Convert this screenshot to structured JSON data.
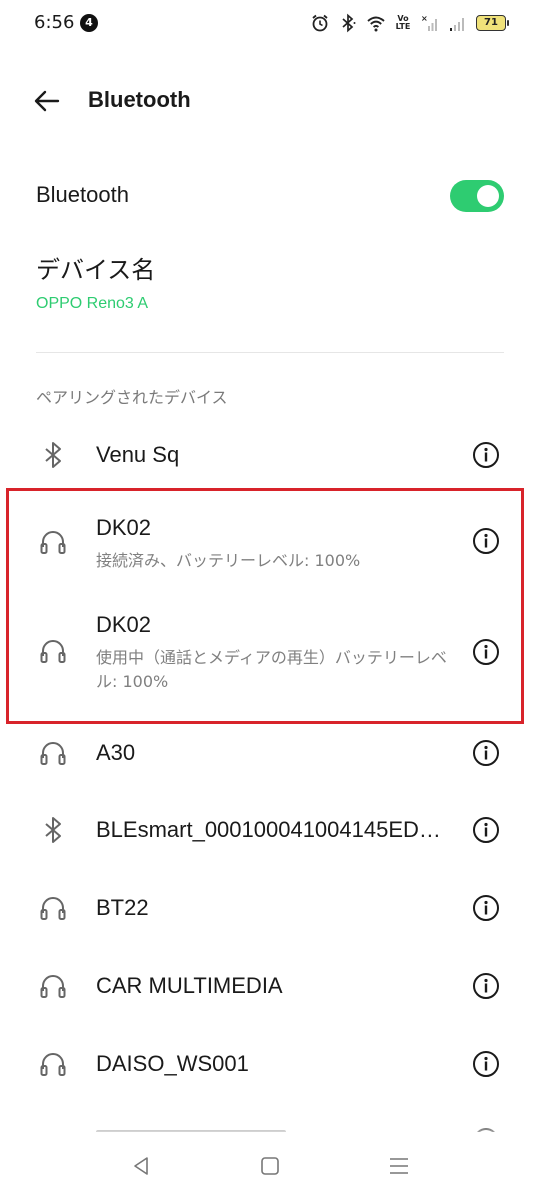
{
  "status_bar": {
    "time": "6:56",
    "notification_count": "4",
    "volte": "Vo LTE",
    "battery": "71"
  },
  "header": {
    "title": "Bluetooth"
  },
  "bluetooth_toggle": {
    "label": "Bluetooth",
    "enabled": true,
    "accent_color": "#2ecc71"
  },
  "device_name": {
    "label": "デバイス名",
    "value": "OPPO Reno3 A"
  },
  "paired_section": {
    "title": "ペアリングされたデバイス",
    "devices": [
      {
        "name": "Venu Sq",
        "icon": "bluetooth-icon",
        "status": ""
      },
      {
        "name": "DK02",
        "icon": "headphones-icon",
        "status": "接続済み、バッテリーレベル: 100%"
      },
      {
        "name": "DK02",
        "icon": "headphones-icon",
        "status": "使用中（通話とメディアの再生）バッテリーレベル: 100%"
      },
      {
        "name": "A30",
        "icon": "headphones-icon",
        "status": ""
      },
      {
        "name": "BLEsmart_000100041004145ED…",
        "icon": "bluetooth-icon",
        "status": ""
      },
      {
        "name": "BT22",
        "icon": "headphones-icon",
        "status": ""
      },
      {
        "name": "CAR MULTIMEDIA",
        "icon": "headphones-icon",
        "status": ""
      },
      {
        "name": "DAISO_WS001",
        "icon": "headphones-icon",
        "status": ""
      }
    ]
  },
  "highlight_color": "#d8232a"
}
